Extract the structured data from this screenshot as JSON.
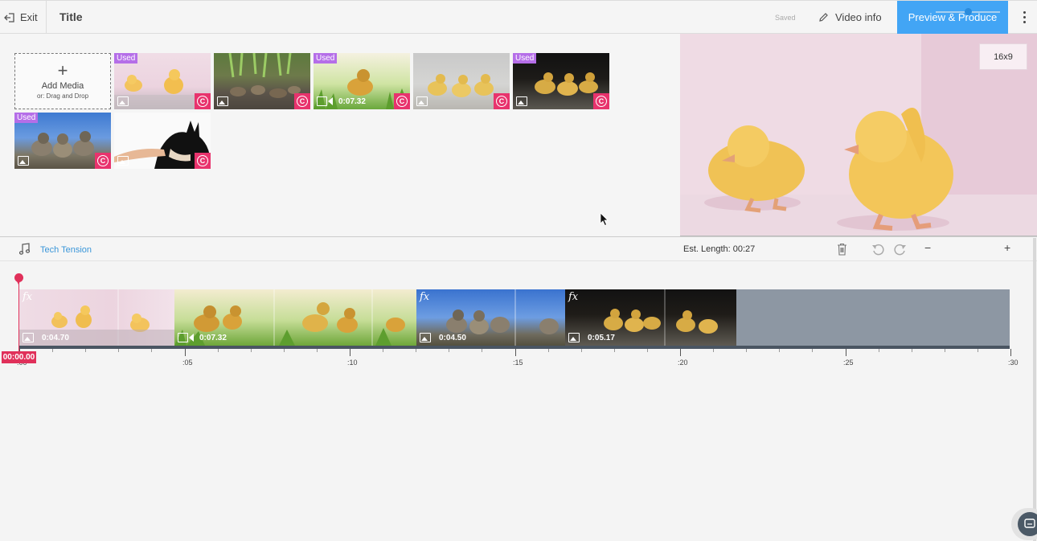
{
  "header": {
    "exit_label": "Exit",
    "title": "Title",
    "saved_label": "Saved",
    "video_info_label": "Video info",
    "preview_label": "Preview & Produce"
  },
  "library": {
    "add_media_label": "Add Media",
    "add_media_hint": "or: Drag and Drop",
    "used_badge": "Used",
    "copyright_glyph": "C",
    "items": [
      {
        "used": true,
        "type": "image",
        "duration": ""
      },
      {
        "used": false,
        "type": "image",
        "duration": ""
      },
      {
        "used": true,
        "type": "video",
        "duration": "0:07.32"
      },
      {
        "used": false,
        "type": "image",
        "duration": ""
      },
      {
        "used": true,
        "type": "image",
        "duration": ""
      },
      {
        "used": true,
        "type": "image",
        "duration": ""
      },
      {
        "used": false,
        "type": "image",
        "duration": ""
      }
    ]
  },
  "preview": {
    "ratio_label": "16x9"
  },
  "timeline": {
    "music_track": "Tech Tension",
    "est_length": "Est. Length: 00:27",
    "current_time": "00:00.00",
    "fx_label": "fx",
    "clips": [
      {
        "type": "image",
        "duration": "0:04.70",
        "fx": true
      },
      {
        "type": "video",
        "duration": "0:07.32",
        "fx": false
      },
      {
        "type": "image",
        "duration": "0:04.50",
        "fx": true
      },
      {
        "type": "image",
        "duration": "0:05.17",
        "fx": true
      }
    ],
    "ruler_labels": [
      ":00",
      ":05",
      ":10",
      ":15",
      ":20",
      ":25",
      ":30"
    ]
  },
  "colors": {
    "accent": "#42a5f5",
    "used_badge": "#b56ee8",
    "copyright": "#e8336d",
    "playhead": "#e0305a",
    "link": "#3a96d9"
  }
}
